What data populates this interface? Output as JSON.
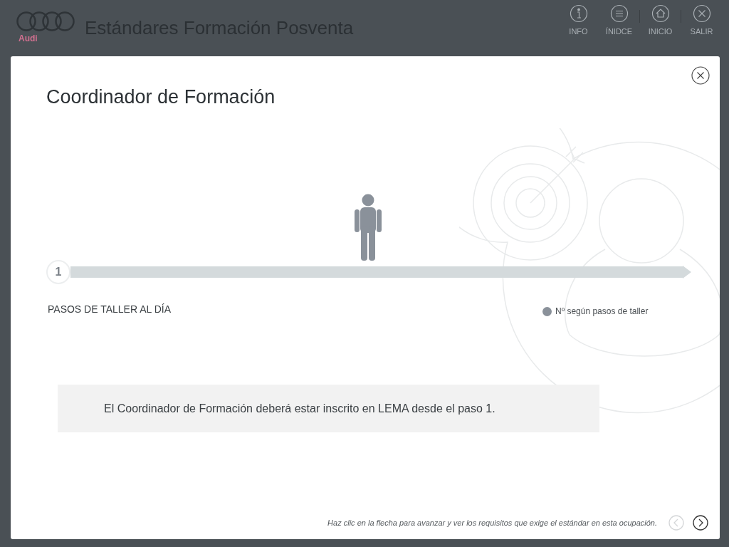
{
  "header": {
    "brand": "Audi",
    "title": "Estándares Formación Posventa",
    "nav": [
      {
        "kind": "info",
        "label": "INFO"
      },
      {
        "kind": "index",
        "label": "ÍNIDCE"
      },
      {
        "kind": "home",
        "label": "INICIO"
      },
      {
        "kind": "exit",
        "label": "SALIR"
      }
    ]
  },
  "dialog": {
    "title": "Coordinador de Formación",
    "timeline": {
      "step": "1",
      "axis_label": "PASOS DE TALLER AL DÍA",
      "legend": "Nº según pasos de taller"
    },
    "note": "El Coordinador de Formación deberá estar inscrito en LEMA desde el paso 1.",
    "footer_hint": "Haz clic en la flecha para avanzar y ver los requisitos que exige el estándar en esta ocupación.",
    "pager": [
      {
        "kind": "prev",
        "disabled": true
      },
      {
        "kind": "next",
        "disabled": false
      }
    ]
  }
}
